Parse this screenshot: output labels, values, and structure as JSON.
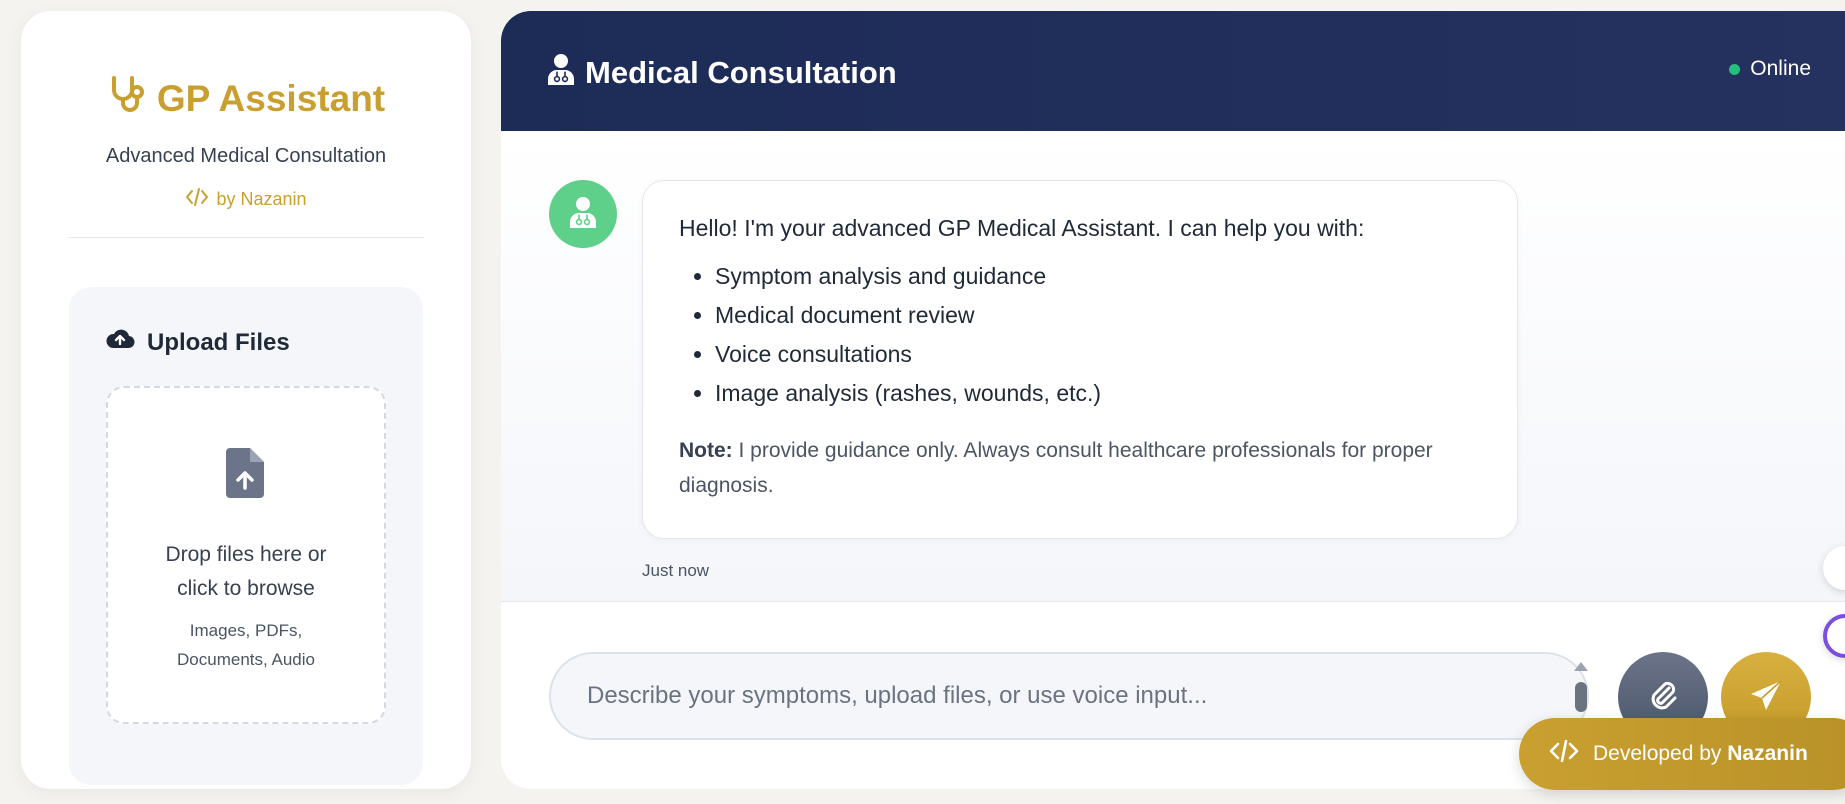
{
  "sidebar": {
    "brand_title": "GP Assistant",
    "brand_subtitle": "Advanced Medical Consultation",
    "brand_by": "by Nazanin",
    "upload": {
      "title": "Upload Files",
      "drop_text": "Drop files here or click to browse",
      "hint": "Images, PDFs, Documents, Audio"
    }
  },
  "chat": {
    "title": "Medical Consultation",
    "status": "Online",
    "message": {
      "intro": "Hello! I'm your advanced GP Medical Assistant. I can help you with:",
      "items": [
        "Symptom analysis and guidance",
        "Medical document review",
        "Voice consultations",
        "Image analysis (rashes, wounds, etc.)"
      ],
      "note_label": "Note:",
      "note_text": " I provide guidance only. Always consult healthcare professionals for proper diagnosis.",
      "time": "Just now"
    },
    "input": {
      "placeholder": "Describe your symptoms, upload files, or use voice input...",
      "value": ""
    }
  },
  "badge": {
    "prefix": "Developed by",
    "name": "Nazanin"
  },
  "icons": {
    "brand": "stethoscope-icon",
    "brand_by": "code-icon",
    "upload_title": "cloud-upload-icon",
    "dropzone": "file-upload-icon",
    "header": "doctor-icon",
    "avatar": "doctor-icon",
    "attach": "paperclip-icon",
    "send": "paper-plane-icon",
    "badge": "code-icon"
  },
  "colors": {
    "accent_gold": "#c9a030",
    "header_navy": "#1d2b57",
    "online_green": "#22c07a",
    "avatar_green": "#5fd08a",
    "attach_slate": "#4b556b"
  }
}
